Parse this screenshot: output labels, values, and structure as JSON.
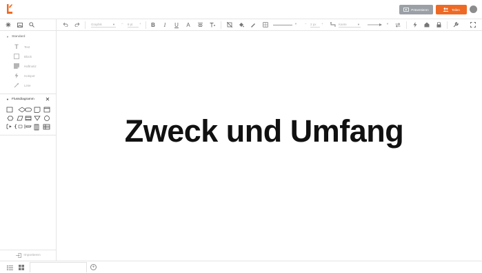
{
  "header": {
    "present_label": "Präsentieren",
    "share_label": "Teilen",
    "accent_color": "#ee6a24"
  },
  "toolbar": {
    "font_select": "Graphik",
    "font_size": "8 pt",
    "line_width": "2 px",
    "connector_type": "Kante"
  },
  "sidebar": {
    "standard_section": "Standard",
    "standard_items": [
      "Text",
      "Block",
      "Haftnotiz",
      "Hotspot",
      "Linie"
    ],
    "flowchart_section": "Flussdiagramm",
    "import_label": "Importieren"
  },
  "canvas": {
    "title": "Zweck und Umfang"
  }
}
